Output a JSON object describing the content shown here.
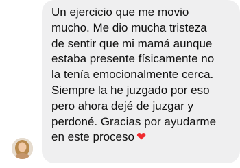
{
  "message": {
    "text": "Un ejercicio que me movio\nmucho. Me dio mucha tristeza\nde sentir que mi mamá aunque\nestaba presente físicamente no\nla tenía emocionalmente cerca.\nSiempre la he juzgado por eso\npero ahora dejé de juzgar y\nperdoné. Gracias por ayudarme\nen este proceso",
    "emoji": "❤",
    "emoji_name": "red-heart-icon",
    "bubble_color": "#efeff0",
    "text_color": "#111111"
  },
  "sender": {
    "avatar_icon": "user-avatar"
  }
}
